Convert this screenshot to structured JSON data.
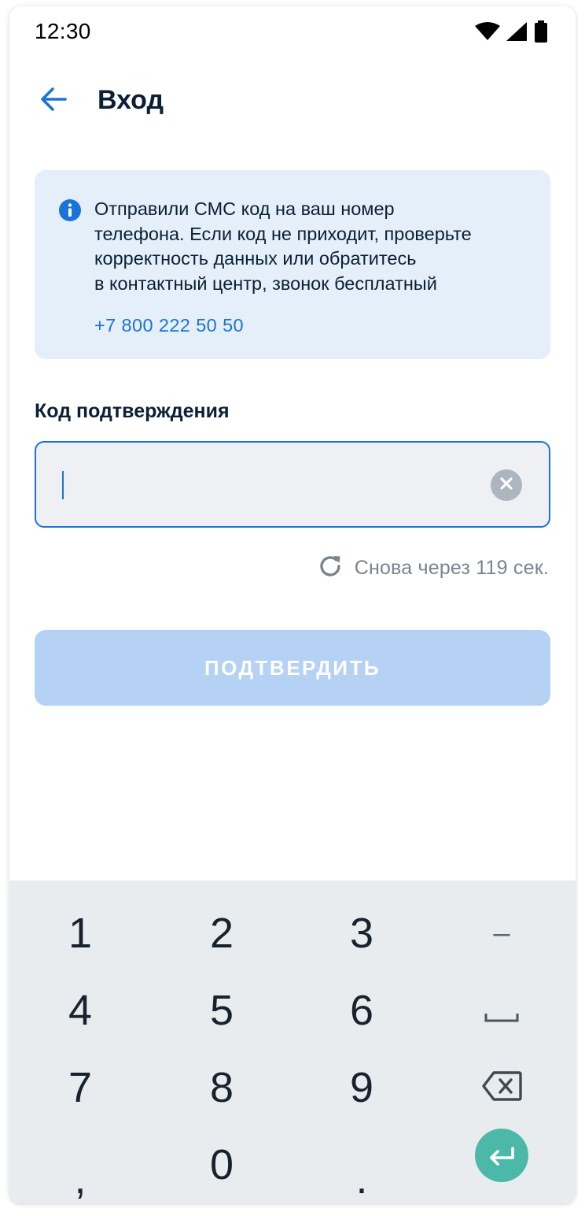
{
  "status_bar": {
    "time": "12:30",
    "icons": [
      "wifi-icon",
      "cellular-signal-icon",
      "battery-icon"
    ]
  },
  "app_bar": {
    "back_icon": "arrow-back-icon",
    "title": "Вход"
  },
  "info_card": {
    "icon": "info-icon",
    "text": "Отправили СМС код на ваш номер\nтелефона. Если код не приходит, проверьте\nкорректность данных или обратитесь\nв контактный центр, звонок бесплатный",
    "phone": "+7 800 222 50 50"
  },
  "code_field": {
    "label": "Код подтверждения",
    "value": "",
    "placeholder": "",
    "clear_icon": "clear-icon"
  },
  "resend": {
    "icon": "refresh-icon",
    "text": "Снова через 119 сек."
  },
  "confirm_button": {
    "label": "ПОДТВЕРДИТЬ",
    "enabled": false
  },
  "keyboard": {
    "rows": [
      [
        "1",
        "2",
        "3",
        "–"
      ],
      [
        "4",
        "5",
        "6",
        "space"
      ],
      [
        "7",
        "8",
        "9",
        "backspace"
      ],
      [
        ",",
        "0",
        ".",
        "enter"
      ]
    ]
  },
  "colors": {
    "accent": "#1a73d9",
    "info_bg": "#e4eff9",
    "field_bg": "#eef0f4",
    "button_disabled": "#b5d1f4",
    "keyboard_bg": "#e9ecee",
    "enter_key": "#4cb9a8",
    "muted_text": "#7a8390"
  }
}
